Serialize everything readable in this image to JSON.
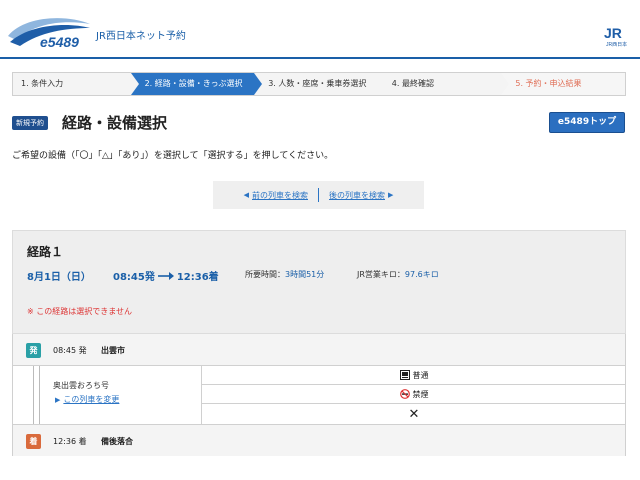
{
  "header": {
    "logo_text": "e5489",
    "service_name": "JR西日本ネット予約",
    "jr_logo_text": "JR西日本"
  },
  "steps": [
    {
      "label": "1. 条件入力"
    },
    {
      "label": "2. 経路・設備・きっぷ選択"
    },
    {
      "label": "3. 人数・座席・乗車券選択"
    },
    {
      "label": "4. 最終確認"
    },
    {
      "label": "5. 予約・申込結果"
    }
  ],
  "title": {
    "badge": "新規予約",
    "text": "経路・設備選択",
    "top_button": "e5489トップ"
  },
  "instruction": "ご希望の設備（「〇」「△」「あり」）を選択して「選択する」を押してください。",
  "pager": {
    "prev": "前の列車を検索",
    "next": "後の列車を検索"
  },
  "route": {
    "label": "経路１",
    "date": "8月1日（日）",
    "dep_time": "08:45発",
    "arr_time": "12:36着",
    "duration_label": "所要時間：",
    "duration_value": "3時間51分",
    "distance_label": "JR営業キロ：",
    "distance_value": "97.6キロ",
    "warning": "※ この経路は選択できません"
  },
  "segment": {
    "dep_badge": "発",
    "dep_time": "08:45 発",
    "dep_station": "出雲市",
    "train_name": "奥出雲おろち号",
    "change_link": "この列車を変更",
    "facility_1": "普通",
    "facility_2": "禁煙",
    "facility_3": "✕",
    "arr_badge": "着",
    "arr_time": "12:36 着",
    "arr_station": "備後落合"
  },
  "colors": {
    "brand_blue": "#1a5fa8",
    "active_step": "#2b74c4",
    "warning": "#dd3333"
  }
}
